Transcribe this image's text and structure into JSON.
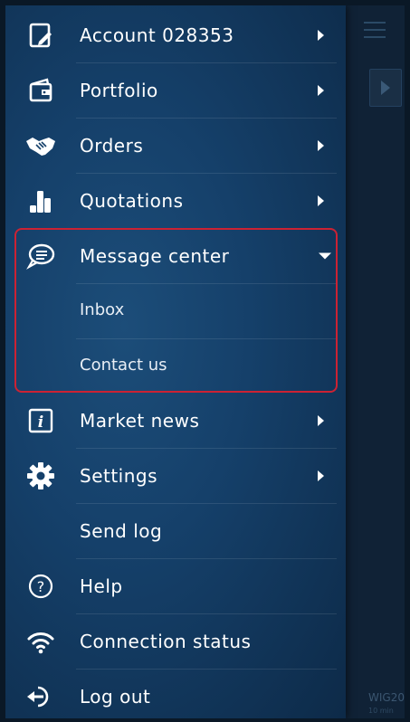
{
  "menu": {
    "items": [
      {
        "label": "Account 028353",
        "icon": "account-icon",
        "arrow": "right"
      },
      {
        "label": "Portfolio",
        "icon": "wallet-icon",
        "arrow": "right"
      },
      {
        "label": "Orders",
        "icon": "handshake-icon",
        "arrow": "right"
      },
      {
        "label": "Quotations",
        "icon": "bar-chart-icon",
        "arrow": "right"
      },
      {
        "label": "Message center",
        "icon": "chat-icon",
        "arrow": "down"
      },
      {
        "label": "Market news",
        "icon": "info-icon",
        "arrow": "right"
      },
      {
        "label": "Settings",
        "icon": "gear-icon",
        "arrow": "right"
      },
      {
        "label": "Send log",
        "icon": "",
        "arrow": ""
      },
      {
        "label": "Help",
        "icon": "help-icon",
        "arrow": ""
      },
      {
        "label": "Connection status",
        "icon": "wifi-icon",
        "arrow": ""
      },
      {
        "label": "Log out",
        "icon": "logout-icon",
        "arrow": ""
      }
    ],
    "message_center_sub": [
      "Inbox",
      "Contact us"
    ]
  },
  "background": {
    "ticker": "WIG20",
    "ticker_sub": "10 min"
  },
  "colors": {
    "drawer": "#15406a",
    "highlight": "#cc2233",
    "text": "#ffffff"
  }
}
